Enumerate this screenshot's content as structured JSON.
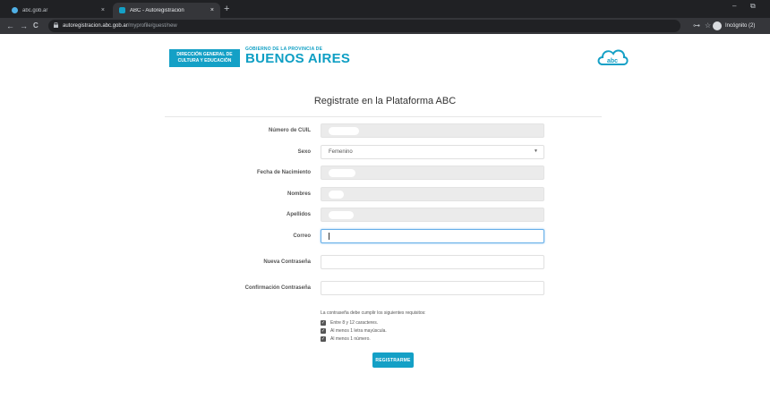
{
  "browser": {
    "tabs": [
      {
        "label": "abc.gob.ar",
        "close": "×",
        "favicon_color": "#4fb0e6"
      },
      {
        "label": "ABC - Autoregistración",
        "close": "×",
        "favicon_color": "#14a0c6"
      }
    ],
    "new_tab": "+",
    "window_controls": {
      "minimize": "–",
      "maximize": "⧉"
    },
    "nav": {
      "back": "←",
      "forward": "→",
      "reload": "C"
    },
    "url": {
      "lock": "🔒",
      "host": "autoregistracion.abc.gob.ar",
      "path": "/myprofile/guest/new"
    },
    "toolbar_icons": {
      "key": "⊶",
      "star": "☆"
    },
    "profile_label": "Incógnito (2)"
  },
  "header": {
    "logo_dge": [
      "DIRECCIÓN GENERAL DE",
      "CULTURA Y EDUCACIÓN"
    ],
    "logo_gov_small": "GOBIERNO DE LA PROVINCIA DE",
    "logo_gov_big": "BUENOS AIRES",
    "cloud_logo_text": "abc"
  },
  "form": {
    "title": "Registrate en la Plataforma ABC",
    "fields": {
      "cuil": {
        "label": "Número de CUIL"
      },
      "sexo": {
        "label": "Sexo",
        "value": "Femenino"
      },
      "fecha": {
        "label": "Fecha de Nacimiento"
      },
      "nombres": {
        "label": "Nombres"
      },
      "apellidos": {
        "label": "Apellidos"
      },
      "correo": {
        "label": "Correo"
      },
      "nueva": {
        "label": "Nueva Contraseña"
      },
      "confirmacion": {
        "label": "Confirmación Contraseña"
      }
    },
    "requirements": {
      "heading": "La contraseña debe cumplir los siguientes requisitos:",
      "items": [
        "Entre 8 y 12 caracteres.",
        "Al menos 1 letra mayúscula.",
        "Al menos 1 número."
      ]
    },
    "submit_label": "REGISTRARME"
  },
  "colors": {
    "accent": "#14a0c6",
    "browser_dark": "#202124"
  }
}
